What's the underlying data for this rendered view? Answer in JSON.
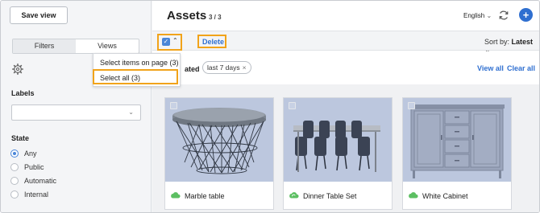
{
  "sidebar": {
    "save_view": "Save view",
    "tabs": {
      "filters": "Filters",
      "views": "Views"
    },
    "labels_heading": "Labels",
    "state_heading": "State",
    "state_options": [
      "Any",
      "Public",
      "Automatic",
      "Internal"
    ],
    "state_selected": "Any"
  },
  "menu": {
    "select_page": "Select items on page (3)",
    "select_all": "Select all (3)"
  },
  "header": {
    "title": "Assets",
    "count": "3 / 3",
    "language": "English",
    "add_symbol": "+"
  },
  "toolbar": {
    "delete": "Delete",
    "sort_prefix": "Sort by:",
    "sort_value": "Latest"
  },
  "filters": {
    "truncated_label": "ated",
    "chip": "last 7 days",
    "view_all": "View all",
    "clear_all": "Clear all"
  },
  "assets": [
    {
      "name": "Marble table",
      "sync_icon": "cloud-icon"
    },
    {
      "name": "Dinner Table Set",
      "sync_icon": "cloud-sync-icon"
    },
    {
      "name": "White Cabinet",
      "sync_icon": "cloud-icon"
    }
  ],
  "colors": {
    "accent": "#2f6fd0",
    "highlight": "#f1a31a",
    "cloud": "#5cbf62",
    "thumb_bg": "#bcc7de"
  }
}
